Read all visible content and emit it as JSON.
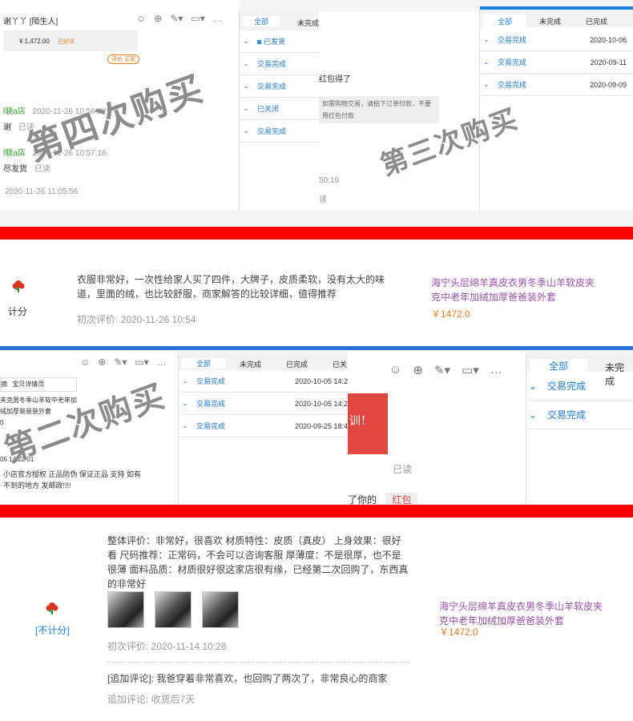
{
  "screenshot_top": {
    "chat_left": {
      "title": "谢丫丫 [陌生人]",
      "order_price": "¥ 1,472.00",
      "order_status": "已好评",
      "order_button": "评价 买家",
      "messages": [
        {
          "sender": "l骁a店",
          "time": "2020-11-26 10:56:22",
          "text": "谢",
          "read": "已读"
        },
        {
          "sender": "l骁a店",
          "time": "2020-11-26 10:57:16",
          "text": "尽发货",
          "read": "已读"
        },
        {
          "time": "2020-11-26 11:05:56"
        }
      ]
    },
    "orders_panel_left": {
      "tabs": [
        "全部",
        "未完成"
      ],
      "rows": [
        "已发货",
        "交易完成",
        "交易完成",
        "已关闭",
        "交易完成"
      ]
    },
    "chat_mid": {
      "line1": "红包得了",
      "bubble": "如需购物交易，请拍下订单付款，不要用红包付款",
      "time": "50:19",
      "read": "读"
    },
    "orders_panel_right": {
      "tabs": [
        "全部",
        "未完成",
        "已完成"
      ],
      "rows": [
        {
          "status": "交易完成",
          "date": "2020-10-06"
        },
        {
          "status": "交易完成",
          "date": "2020-09-11"
        },
        {
          "status": "交易完成",
          "date": "2020-09-09"
        }
      ]
    },
    "watermark_a": "第四次购买",
    "watermark_b": "第三次购买"
  },
  "review1": {
    "rating_label": "计分",
    "text": "衣服非常好，一次性给家人买了四件，大牌子，皮质柔软，没有太大的味道，里面的绒，也比较舒服，商家解答的比较详细，值得推荐",
    "time": "初次评价: 2020-11-26 10:54",
    "product_name": "海宁头层绵羊真皮衣男冬季山羊软皮夹克中老年加绒加厚爸爸装外套",
    "product_price": "￥1472.0"
  },
  "screenshot_mid": {
    "chat_left": {
      "tabs_label": "宝贝详情页",
      "left_clip": "摘",
      "product": "夹克男冬季山羊软中老年加绒加厚爸爸装外套",
      "product_suffix": "0",
      "time": "05 14:22:01",
      "msg": "小店官方授权 正品防伪 保证正品 支持 如有不到的地方 发邮政!!!!"
    },
    "orders_panel_left": {
      "tabs": [
        "全部",
        "未完成",
        "已完成",
        "已关"
      ],
      "rows": [
        {
          "status": "交易完成",
          "date": "2020-10-05 14:2"
        },
        {
          "status": "交易完成",
          "date": "2020-10-05 14:2"
        },
        {
          "status": "交易完成",
          "date": "2020-09-25 18:4"
        }
      ]
    },
    "chat_right": {
      "bubble_text": "训！",
      "read": "已读",
      "clip_text": "了你的",
      "red_label": "红包"
    },
    "orders_panel_right": {
      "tabs": [
        "全部",
        "未完成"
      ],
      "rows": [
        "交易完成",
        "交易完成"
      ]
    },
    "watermark": "第二次购买"
  },
  "review2": {
    "rating_label": "[不计分]",
    "text": "整体评价：非常好，很喜欢 材质特性：皮质（真皮） 上身效果：很好看 尺码推荐：正常码，不会可以咨询客服 厚薄度：不是很厚，也不是很薄 面料品质：材质很好很这家店很有缘，已经第二次回购了，东西真的非常好",
    "time": "初次评价: 2020-11-14 10:28",
    "followup": "[追加评论]: 我爸穿着非常喜欢，也回购了两次了，非常良心的商家",
    "followup_time": "追加评论: 收货后7天",
    "product_name": "海宁头层绵羊真皮衣男冬季山羊软皮夹克中老年加绒加厚爸爸装外套",
    "product_price": "￥1472.0"
  },
  "colors": {
    "accent": "#1a7de0",
    "red_bar": "#ff0000",
    "product": "#9b4fb0",
    "price": "#f07a1c"
  }
}
